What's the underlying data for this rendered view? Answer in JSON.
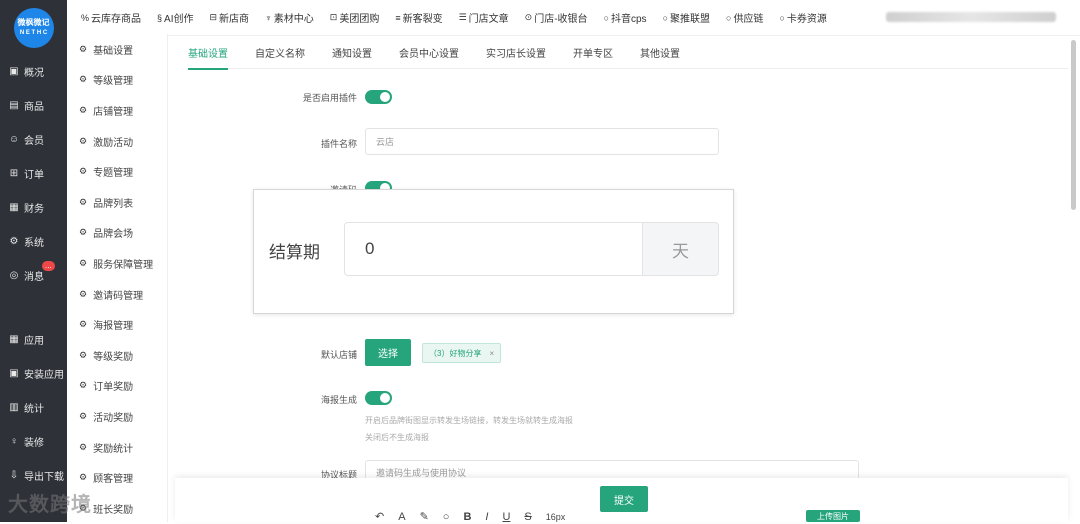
{
  "logo": {
    "line1": "微枫微记",
    "line2": "N E T H C"
  },
  "left_rail": {
    "items_top": [
      {
        "label": "概况",
        "icon": "chart-icon",
        "glyph": "▣"
      },
      {
        "label": "商品",
        "icon": "box-icon",
        "glyph": "▤"
      },
      {
        "label": "会员",
        "icon": "users-icon",
        "glyph": "☺"
      },
      {
        "label": "订单",
        "icon": "cart-icon",
        "glyph": "⊞"
      },
      {
        "label": "财务",
        "icon": "wallet-icon",
        "glyph": "▦"
      },
      {
        "label": "系统",
        "icon": "settings-icon",
        "glyph": "⚙"
      },
      {
        "label": "消息",
        "icon": "message-icon",
        "glyph": "◎",
        "badge": "..."
      }
    ],
    "items_bottom": [
      {
        "label": "应用",
        "icon": "apps-icon",
        "glyph": "▦"
      },
      {
        "label": "安装应用",
        "icon": "install-icon",
        "glyph": "▣"
      },
      {
        "label": "统计",
        "icon": "stats-icon",
        "glyph": "▥"
      },
      {
        "label": "装修",
        "icon": "decorate-icon",
        "glyph": "♀"
      },
      {
        "label": "导出下载",
        "icon": "download-icon",
        "glyph": "⇩"
      }
    ]
  },
  "sub_nav": {
    "items": [
      "基础设置",
      "等级管理",
      "店铺管理",
      "激励活动",
      "专题管理",
      "品牌列表",
      "品牌会场",
      "服务保障管理",
      "邀请码管理",
      "海报管理",
      "等级奖励",
      "订单奖励",
      "活动奖励",
      "奖励统计",
      "顾客管理",
      "班长奖励"
    ]
  },
  "topbar": {
    "links": [
      {
        "label": "云库存商品",
        "glyph": "%"
      },
      {
        "label": "AI创作",
        "glyph": "§"
      },
      {
        "label": "新店商",
        "glyph": "⊟"
      },
      {
        "label": "素材中心",
        "glyph": "♆"
      },
      {
        "label": "美团团购",
        "glyph": "⊡"
      },
      {
        "label": "新客裂变",
        "glyph": "≡"
      },
      {
        "label": "门店文章",
        "glyph": "☰"
      },
      {
        "label": "门店-收银台",
        "glyph": "⊙"
      },
      {
        "label": "抖音cps",
        "glyph": "○"
      },
      {
        "label": "聚推联盟",
        "glyph": "○"
      },
      {
        "label": "供应链",
        "glyph": "○"
      },
      {
        "label": "卡券资源",
        "glyph": "○"
      }
    ]
  },
  "tabs": [
    "基础设置",
    "自定义名称",
    "通知设置",
    "会员中心设置",
    "实习店长设置",
    "开单专区",
    "其他设置"
  ],
  "form": {
    "enable_plugin_label": "是否启用插件",
    "plugin_name_label": "插件名称",
    "plugin_name_value": "云店",
    "invite_code_label": "邀请码",
    "default_store_label": "默认店铺",
    "select_button": "选择",
    "store_tag": "（3）好物分享",
    "store_tag_close": "×",
    "poster_label": "海报生成",
    "poster_hint_1": "开启后品牌街图显示转发生场链接，转发生场就转生成海报",
    "poster_hint_2": "关闭后不生成海报",
    "agreement_label": "协议标题",
    "agreement_placeholder": "邀请码生成与使用协议"
  },
  "zoom": {
    "label": "结算期",
    "value": "0",
    "unit": "天"
  },
  "editor": {
    "submit": "提交",
    "font_size": "16px",
    "upload": "上传图片"
  },
  "watermark": "大数跨境",
  "colors": {
    "accent": "#26a57c",
    "rail": "#2e3138",
    "logo": "#1e86e8"
  }
}
